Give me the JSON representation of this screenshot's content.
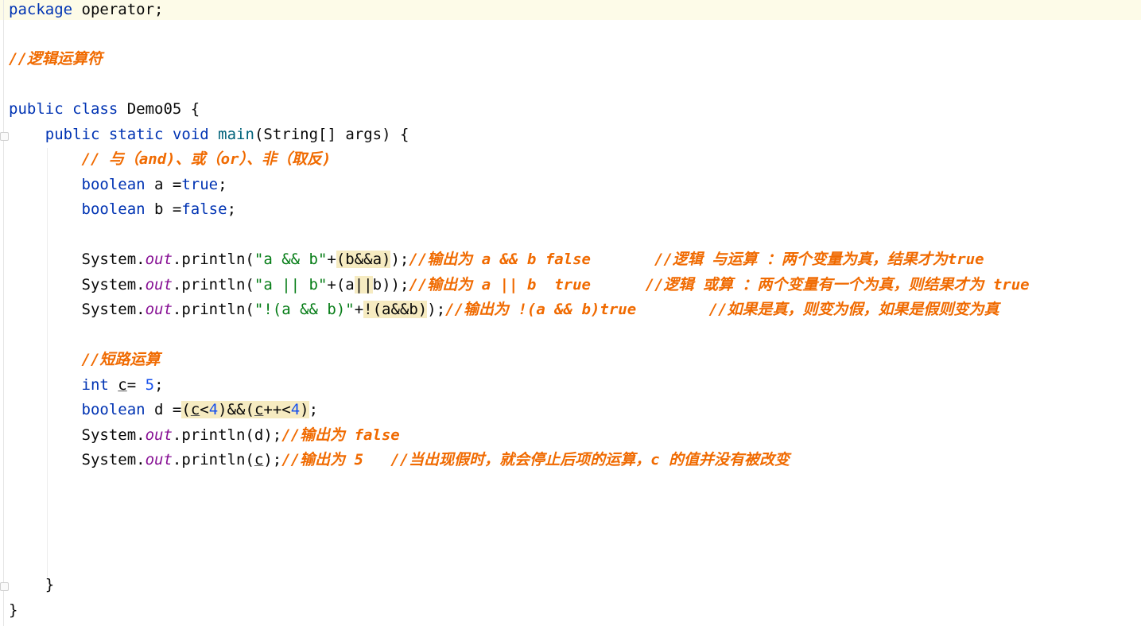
{
  "editor": {
    "file_lines": {
      "l1": {
        "kw": "package",
        "rest": " operator;"
      },
      "l3": {
        "comment": "//逻辑运算符"
      },
      "l5": {
        "kw1": "public",
        "kw2": "class",
        "name": " Demo05 {"
      },
      "l6": {
        "kw1": "public",
        "kw2": "static",
        "kw3": "void",
        "method": "main",
        "rest": "(String[] args) {"
      },
      "l7": {
        "comment": "// 与（and)、或（or）、非（取反)"
      },
      "l8": {
        "kw": "boolean",
        "mid": " a =",
        "val": "true",
        "end": ";"
      },
      "l9": {
        "kw": "boolean",
        "mid": " b =",
        "val": "false",
        "end": ";"
      },
      "l11": {
        "sys": "System.",
        "out": "out",
        "call": ".println(",
        "str": "\"a && b\"",
        "plus": "+",
        "hl": "(b&&a)",
        "end": ");",
        "comment": "//输出为 a && b false       //逻辑 与运算 ：两个变量为真，结果才为true"
      },
      "l12": {
        "sys": "System.",
        "out": "out",
        "call": ".println(",
        "str": "\"a || b\"",
        "plus": "+(",
        "a": "a",
        "bars": "||",
        "b": "b",
        "end": "));",
        "comment": "//输出为 a || b  true      //逻辑 或算 ：两个变量有一个为真，则结果才为 true"
      },
      "l13": {
        "sys": "System.",
        "out": "out",
        "call": ".println(",
        "str": "\"!(a && b)\"",
        "plus": "+",
        "hl": "!(a&&b)",
        "end": ");",
        "comment": "//输出为 !(a && b)true        //如果是真，则变为假，如果是假则变为真"
      },
      "l15": {
        "comment": "//短路运算"
      },
      "l16": {
        "kw": "int",
        "var": "c",
        "mid": "= ",
        "num": "5",
        "end": ";"
      },
      "l17": {
        "kw": "boolean",
        "mid": " d =",
        "p1": "(",
        "c1": "c",
        "lt1": "<",
        "n1": "4",
        "p2": ")&&(",
        "c2": "c",
        "inc": "++<",
        "n2": "4",
        "p3": ")",
        "end": ";"
      },
      "l18": {
        "sys": "System.",
        "out": "out",
        "call": ".println(",
        "arg": "d",
        "end": ");",
        "comment": "//输出为 false"
      },
      "l19": {
        "sys": "System.",
        "out": "out",
        "call": ".println(",
        "arg": "c",
        "end": ");",
        "comment": "//输出为 5   //当出现假时，就会停止后项的运算，c 的值并没有被改变"
      },
      "l24": {
        "text": "}"
      },
      "l25": {
        "text": "}"
      }
    }
  }
}
